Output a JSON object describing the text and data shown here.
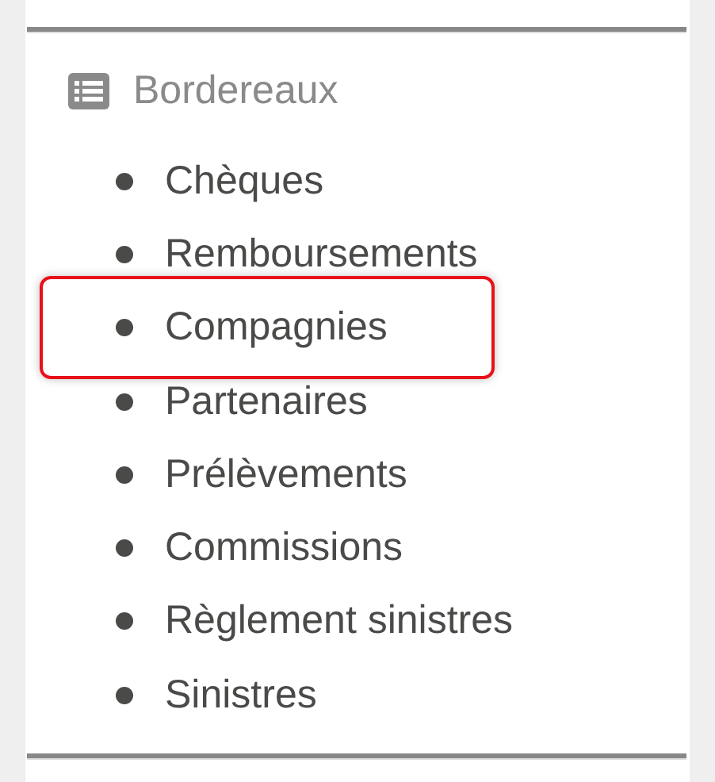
{
  "section": {
    "title": "Bordereaux"
  },
  "items": [
    {
      "label": "Chèques",
      "highlighted": false
    },
    {
      "label": "Remboursements",
      "highlighted": false
    },
    {
      "label": "Compagnies",
      "highlighted": true
    },
    {
      "label": "Partenaires",
      "highlighted": false
    },
    {
      "label": "Prélèvements",
      "highlighted": false
    },
    {
      "label": "Commissions",
      "highlighted": false
    },
    {
      "label": "Règlement sinistres",
      "highlighted": false
    },
    {
      "label": "Sinistres",
      "highlighted": false
    }
  ]
}
